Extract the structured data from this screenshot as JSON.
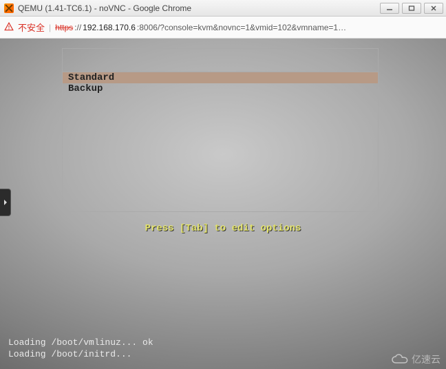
{
  "window": {
    "title": "QEMU (1.41-TC6.1) - noVNC - Google Chrome"
  },
  "addressbar": {
    "warning_label": "不安全",
    "protocol": "https",
    "host": "192.168.170.6",
    "port_path": ":8006/?console=kvm&novnc=1&vmid=102&vmname=1…"
  },
  "boot_menu": {
    "items": [
      {
        "label": "Standard",
        "selected": true
      },
      {
        "label": "Backup",
        "selected": false
      }
    ],
    "hint": "Press [Tab] to edit options"
  },
  "console_log": {
    "lines": [
      "Loading /boot/vmlinuz... ok",
      "Loading /boot/initrd..."
    ]
  },
  "watermark": {
    "text": "亿速云"
  }
}
